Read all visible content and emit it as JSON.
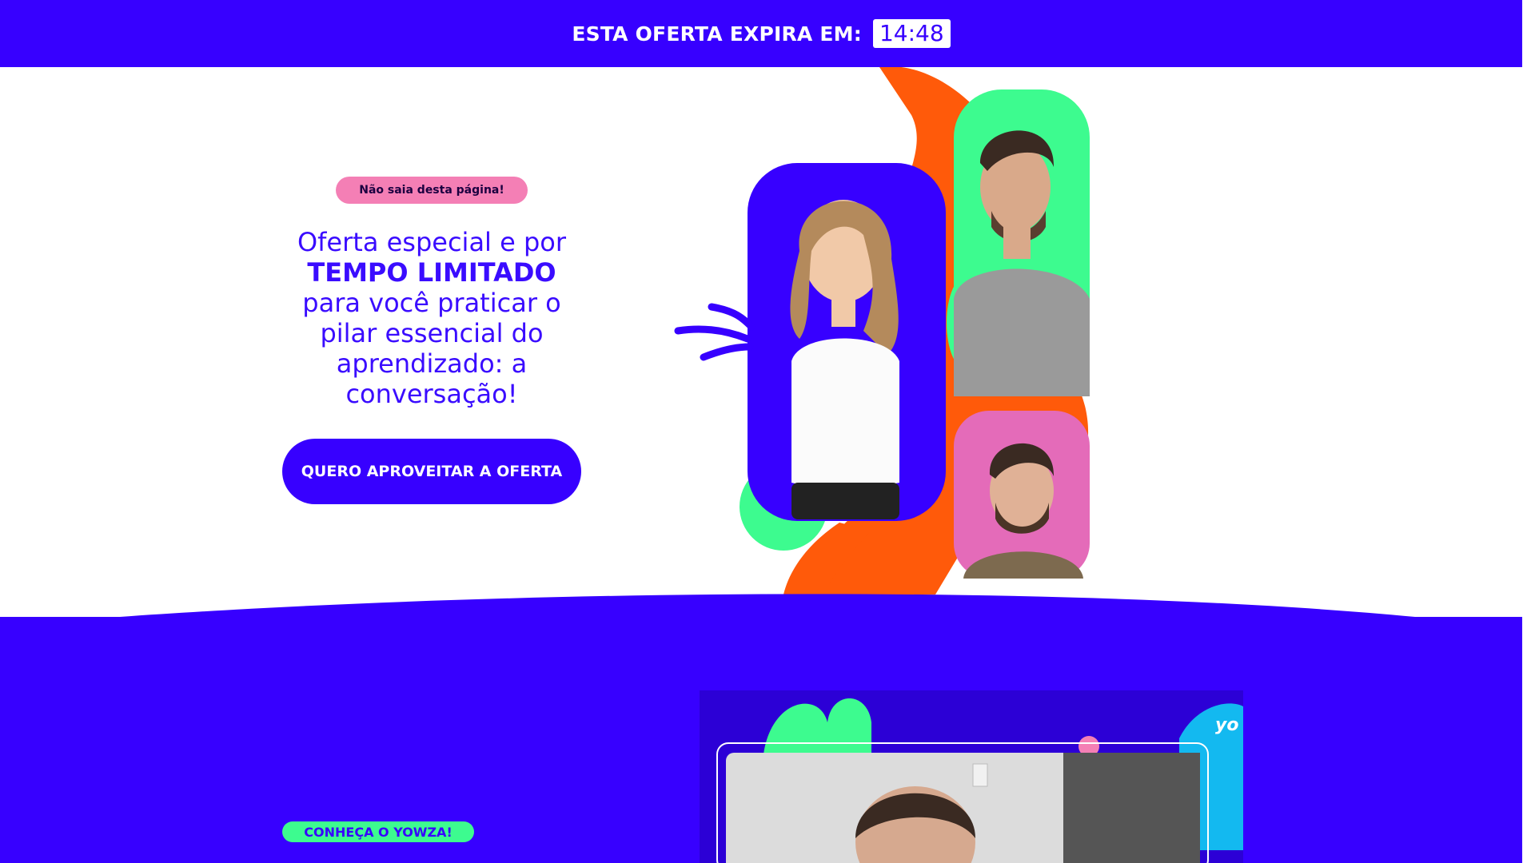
{
  "countdown": {
    "label": "ESTA OFERTA EXPIRA EM:",
    "time": "14:48"
  },
  "hero": {
    "badge": "Não saia desta página!",
    "headline_part1": "Oferta especial e por",
    "headline_bold": "TEMPO LIMITADO",
    "headline_part2": "para você praticar o pilar essencial do aprendizado: a conversação!",
    "cta_label": "QUERO APROVEITAR A OFERTA"
  },
  "section2": {
    "badge": "CONHEÇA O YOWZA!",
    "video_logo_text": "yo"
  },
  "colors": {
    "brand_blue": "#3700ff",
    "orange": "#ff5a0a",
    "green": "#3dfb8f",
    "pink": "#f47fb5"
  }
}
